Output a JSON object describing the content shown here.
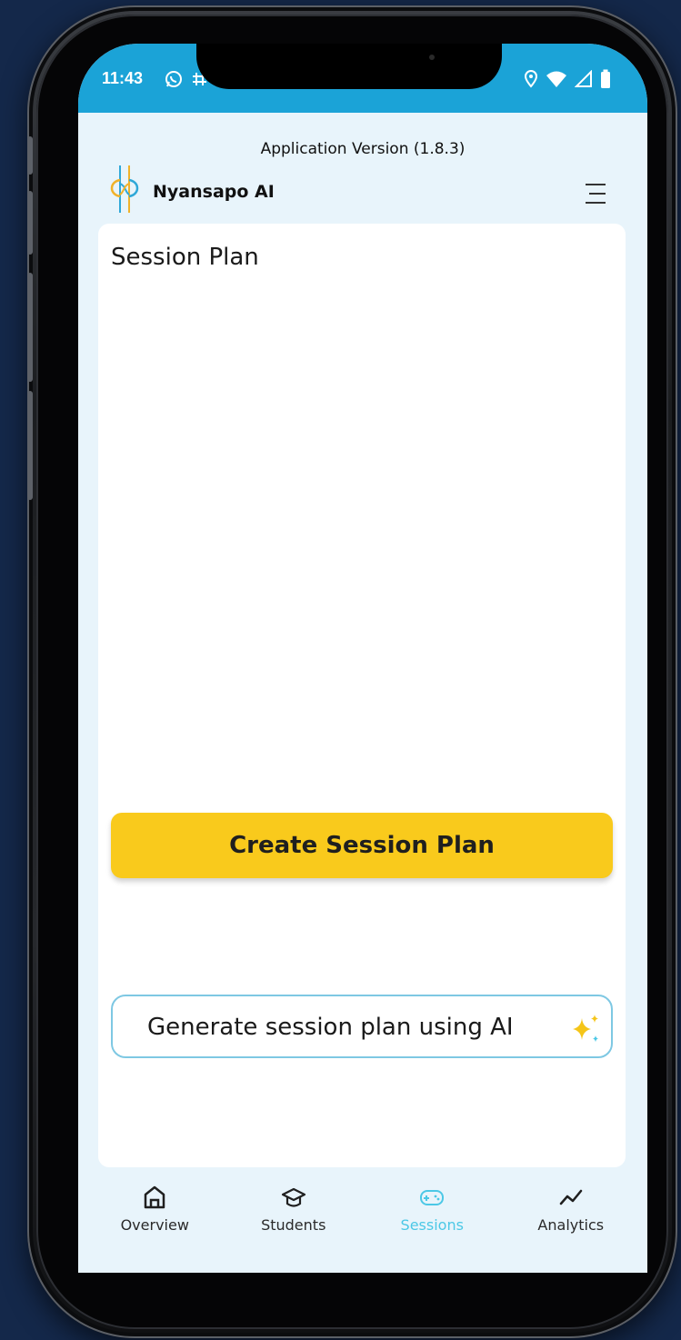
{
  "status_bar": {
    "time": "11:43"
  },
  "header": {
    "app_version": "Application Version (1.8.3)",
    "app_name": "Nyansapo AI"
  },
  "main": {
    "title": "Session Plan",
    "create_button_label": "Create Session Plan",
    "ai_button_label": "Generate session plan using AI"
  },
  "bottom_nav": {
    "items": [
      {
        "label": "Overview",
        "icon": "home-icon"
      },
      {
        "label": "Students",
        "icon": "graduation-cap-icon"
      },
      {
        "label": "Sessions",
        "icon": "gamepad-icon",
        "active": true
      },
      {
        "label": "Analytics",
        "icon": "trend-line-icon"
      }
    ]
  },
  "colors": {
    "status_bar": "#1ba3d7",
    "background": "#e8f4fb",
    "primary_button": "#f9ca1c",
    "active_nav": "#4cc8e6",
    "ai_button_border": "#7ec8e3"
  }
}
